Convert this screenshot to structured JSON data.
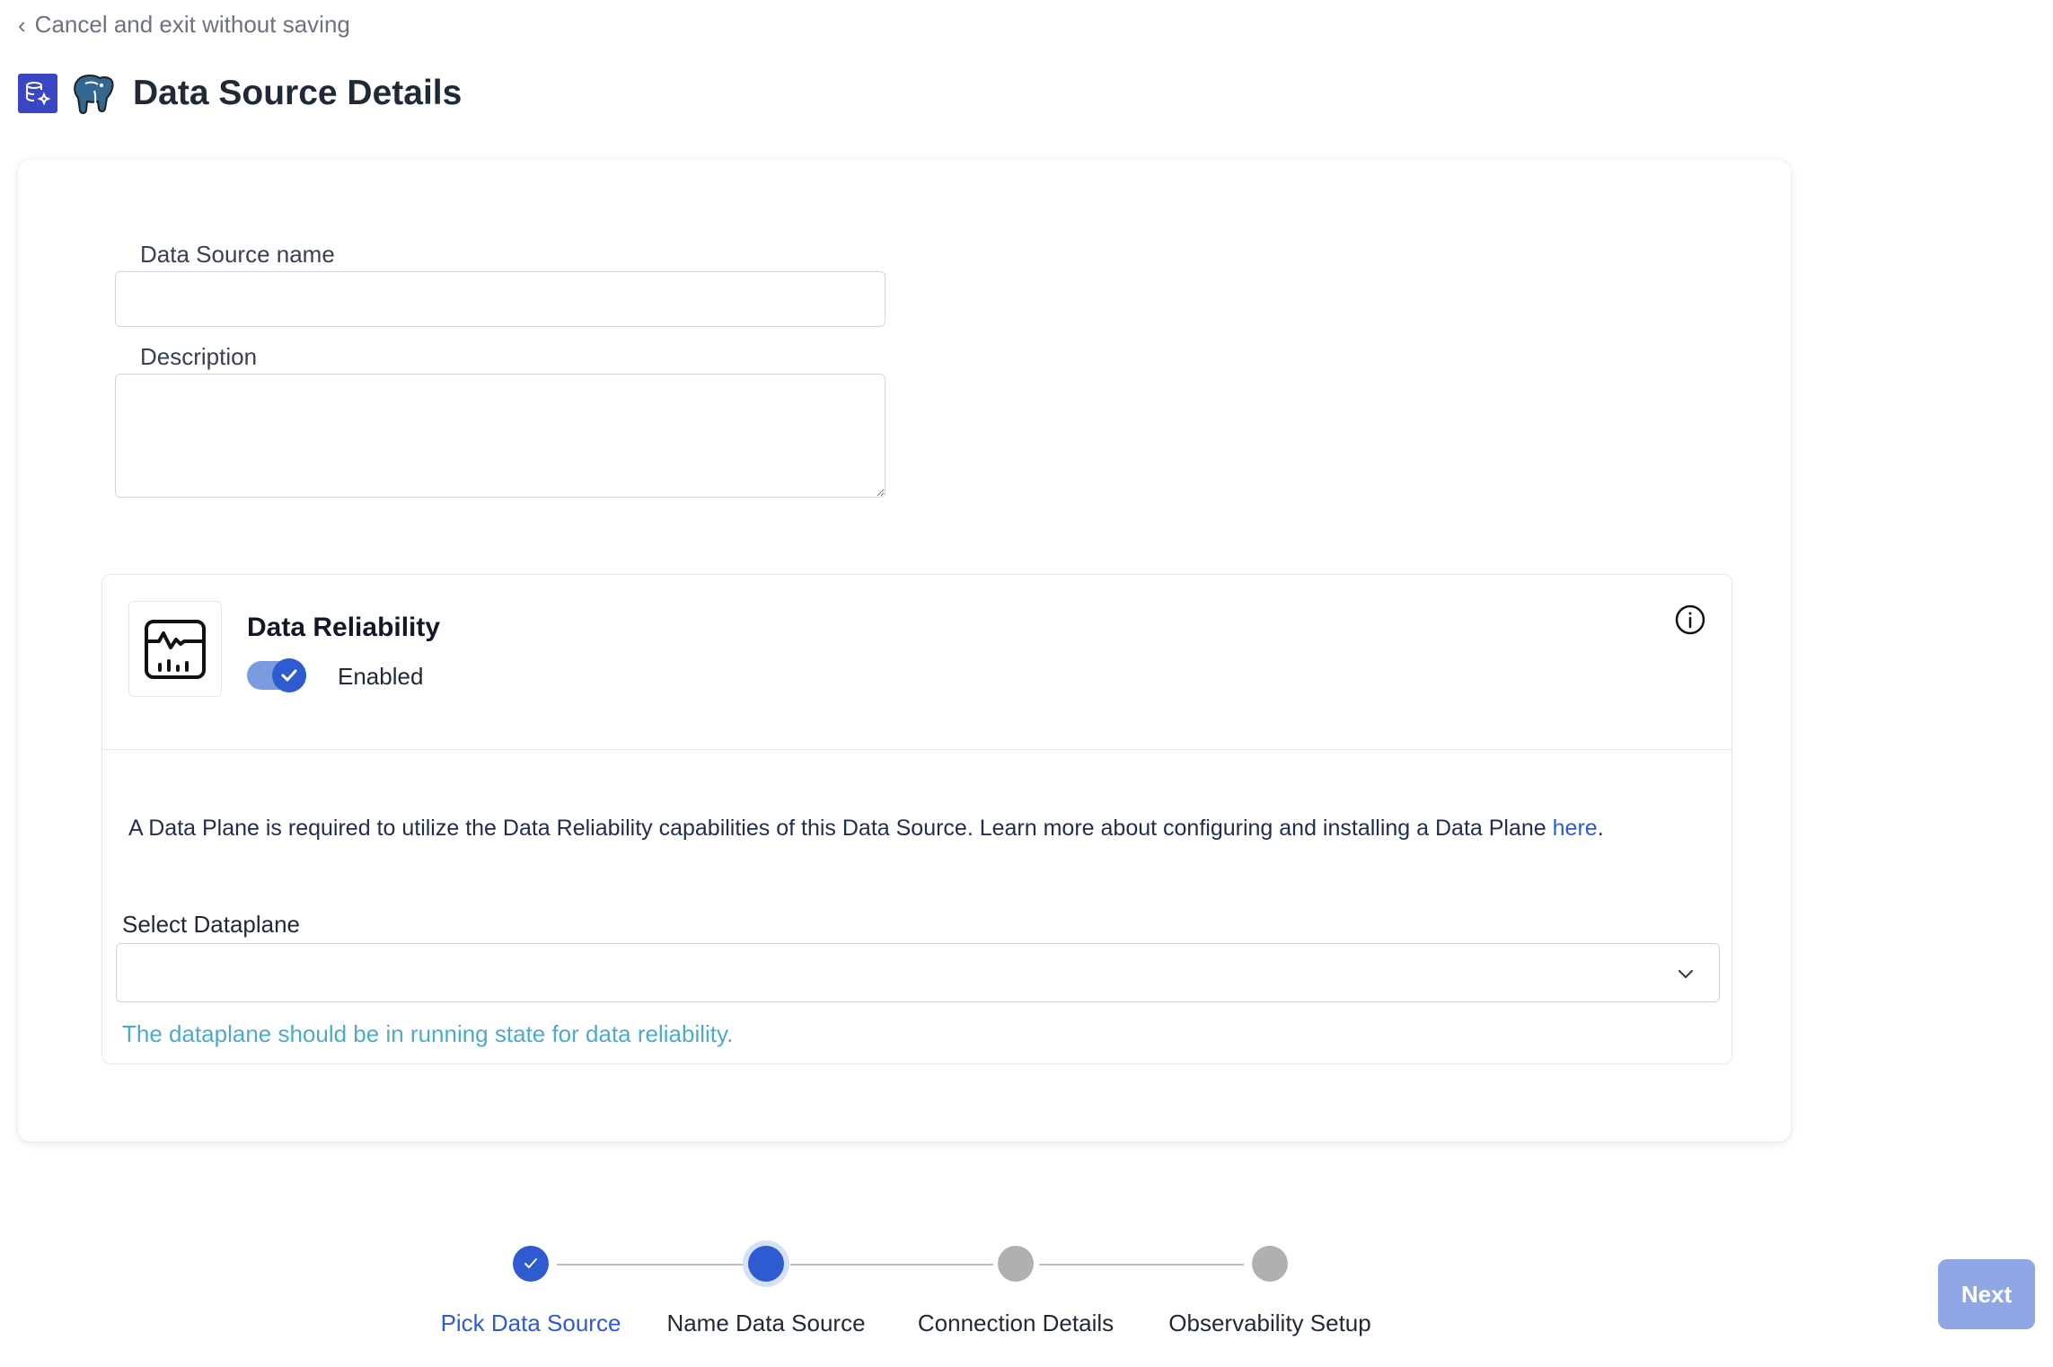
{
  "nav": {
    "back_label": "Cancel and exit without saving"
  },
  "header": {
    "title": "Data Source Details",
    "icons": [
      "database-sparkle-icon",
      "postgresql-elephant-icon"
    ]
  },
  "form": {
    "name_label": "Data Source name",
    "name_value": "",
    "description_label": "Description",
    "description_value": ""
  },
  "reliability": {
    "title": "Data Reliability",
    "toggle_state": "Enabled",
    "toggle_on": true,
    "notice_text": "A Data Plane is required to utilize the Data Reliability capabilities of this Data Source. Learn more about configuring and installing a Data Plane ",
    "notice_link": "here",
    "notice_end": ".",
    "select_label": "Select Dataplane",
    "select_value": "",
    "hint": "The dataplane should be in running state for data reliability."
  },
  "stepper": {
    "steps": [
      {
        "label": "Pick Data Source",
        "state": "done"
      },
      {
        "label": "Name Data Source",
        "state": "current"
      },
      {
        "label": "Connection Details",
        "state": "pending"
      },
      {
        "label": "Observability Setup",
        "state": "pending"
      }
    ]
  },
  "actions": {
    "next_label": "Next"
  },
  "colors": {
    "accent": "#2f5bd0",
    "next_button": "#8fa7e4",
    "hint_text": "#4fa9c8",
    "pending_step": "#b0b0b0"
  }
}
